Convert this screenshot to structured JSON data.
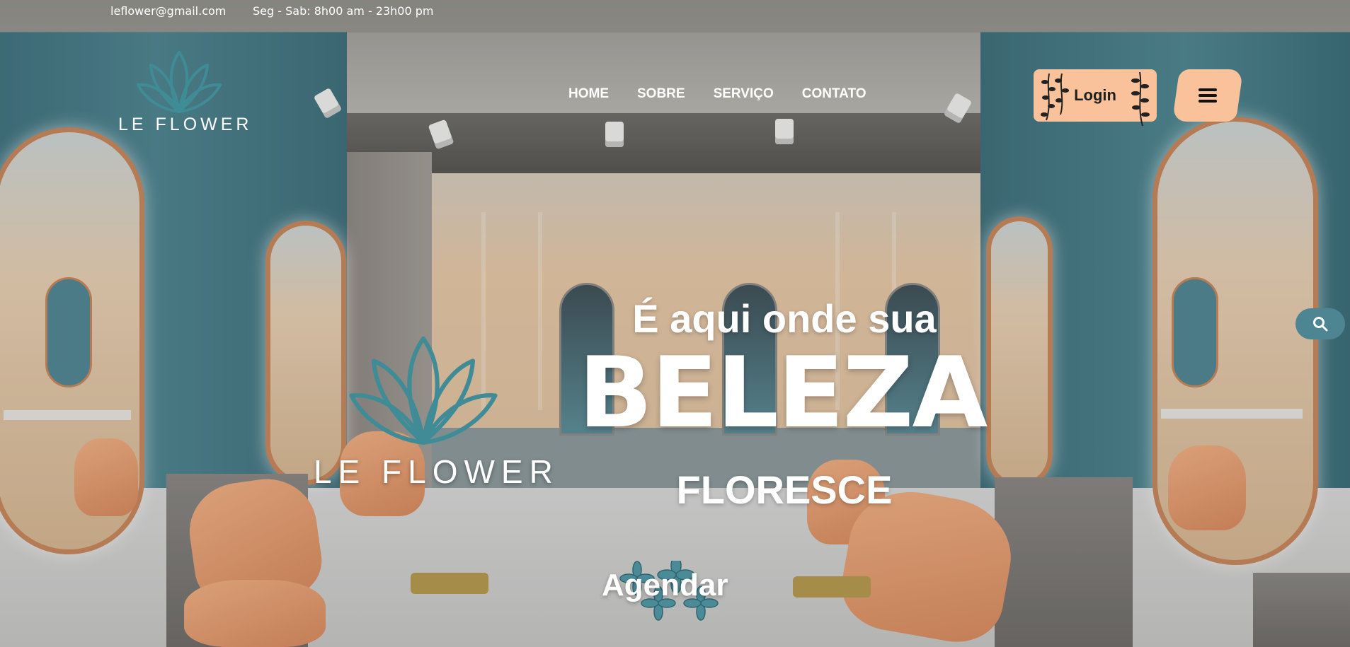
{
  "topbar": {
    "email": "leflower@gmail.com",
    "hours": "Seg - Sab: 8h00 am - 23h00 pm"
  },
  "brand": {
    "name": "LE FLOWER",
    "icon": "lotus-logo-icon",
    "accent": "#3f8c97"
  },
  "nav": {
    "items": [
      "HOME",
      "SOBRE",
      "SERVIÇO",
      "CONTATO"
    ]
  },
  "header": {
    "login_label": "Login",
    "menu_icon": "hamburger-icon",
    "button_color": "#f9c29a"
  },
  "search": {
    "icon": "search-icon"
  },
  "hero": {
    "line1": "É aqui onde sua",
    "line2": "BELEZA",
    "line3": "FLORESCE",
    "cta_label": "Agendar",
    "logo_text": "LE FLOWER"
  }
}
